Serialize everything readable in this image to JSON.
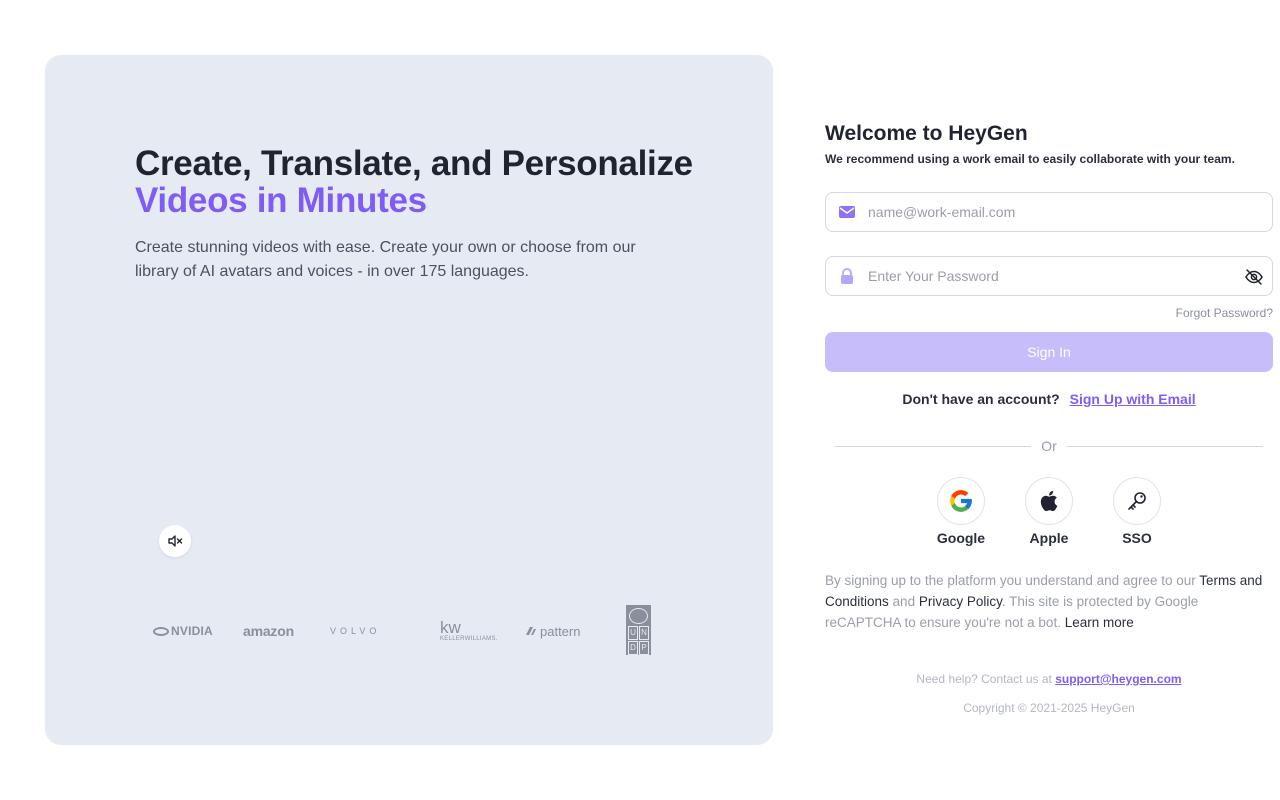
{
  "hero": {
    "title_line1": "Create, Translate, and Personalize",
    "title_line2": "Videos in Minutes",
    "subtitle": "Create stunning videos with ease. Create your own or choose from our library of AI avatars and voices - in over 175 languages.",
    "mute_icon": "speaker-muted-icon",
    "logos": {
      "nvidia": "NVIDIA",
      "amazon": "amazon",
      "volvo": "VOLVO",
      "kw_big": "kw",
      "kw_small": "KELLERWILLIAMS.",
      "pattern": "pattern",
      "undp_letters": [
        "U",
        "N",
        "D",
        "P"
      ]
    }
  },
  "form": {
    "welcome": "Welcome to HeyGen",
    "recommend": "We recommend using a work email to easily collaborate with your team.",
    "email_placeholder": "name@work-email.com",
    "email_value": "",
    "password_placeholder": "Enter Your Password",
    "password_value": "",
    "forgot": "Forgot Password?",
    "signin": "Sign In",
    "no_account": "Don't have an account?",
    "signup_link": "Sign Up with Email",
    "or": "Or",
    "providers": {
      "google": "Google",
      "apple": "Apple",
      "sso": "SSO"
    },
    "legal": {
      "part1": "By signing up to the platform you understand and agree to our ",
      "terms": "Terms and Conditions",
      "part2": " and ",
      "privacy": "Privacy Policy",
      "part3": ". This site is protected by Google reCAPTCHA to ensure you're not a bot. ",
      "learn_more": "Learn more"
    },
    "help_text": "Need help? Contact us at ",
    "help_email": "support@heygen.com",
    "copyright": "Copyright © 2021-2025 HeyGen"
  },
  "colors": {
    "accent": "#7f5cf6",
    "hero_bg": "#e6eaf2",
    "signin_bg": "#c8bdfb"
  }
}
